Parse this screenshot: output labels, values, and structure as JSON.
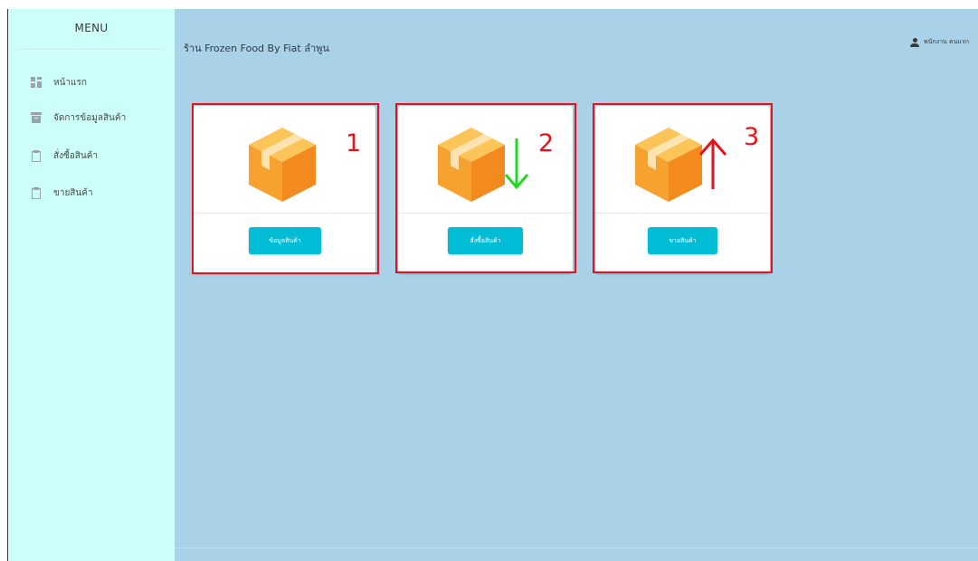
{
  "sidebar": {
    "title": "MENU",
    "items": [
      {
        "icon": "dashboard-icon",
        "label": "หน้าแรก"
      },
      {
        "icon": "archive-icon",
        "label": "จัดการข้อมูลสินค้า"
      },
      {
        "icon": "clipboard-icon",
        "label": "สั่งซื้อสินค้า"
      },
      {
        "icon": "clipboard-icon",
        "label": "ขายสินค้า"
      }
    ]
  },
  "header": {
    "shop_title": "ร้าน Frozen Food By Fiat ลำพูน",
    "user_icon": "user-icon",
    "user_name": "พนักงาน คนแรก"
  },
  "cards": [
    {
      "icon": "package-box-icon",
      "button_label": "ข้อมูลสินค้า",
      "annotation_number": "1",
      "arrow": "none"
    },
    {
      "icon": "package-box-icon",
      "button_label": "สั่งซื้อสินค้า",
      "annotation_number": "2",
      "arrow": "down",
      "arrow_color": "#22d822"
    },
    {
      "icon": "package-box-icon",
      "button_label": "ขายสินค้า",
      "annotation_number": "3",
      "arrow": "up",
      "arrow_color": "#e8101a"
    }
  ],
  "colors": {
    "sidebar_bg": "#cdfffa",
    "main_bg": "#a9d1e7",
    "button_bg": "#00bcd4",
    "annotation_red": "#e8101a",
    "box_orange": "#f7a12f",
    "box_dark_orange": "#f28a1d"
  }
}
